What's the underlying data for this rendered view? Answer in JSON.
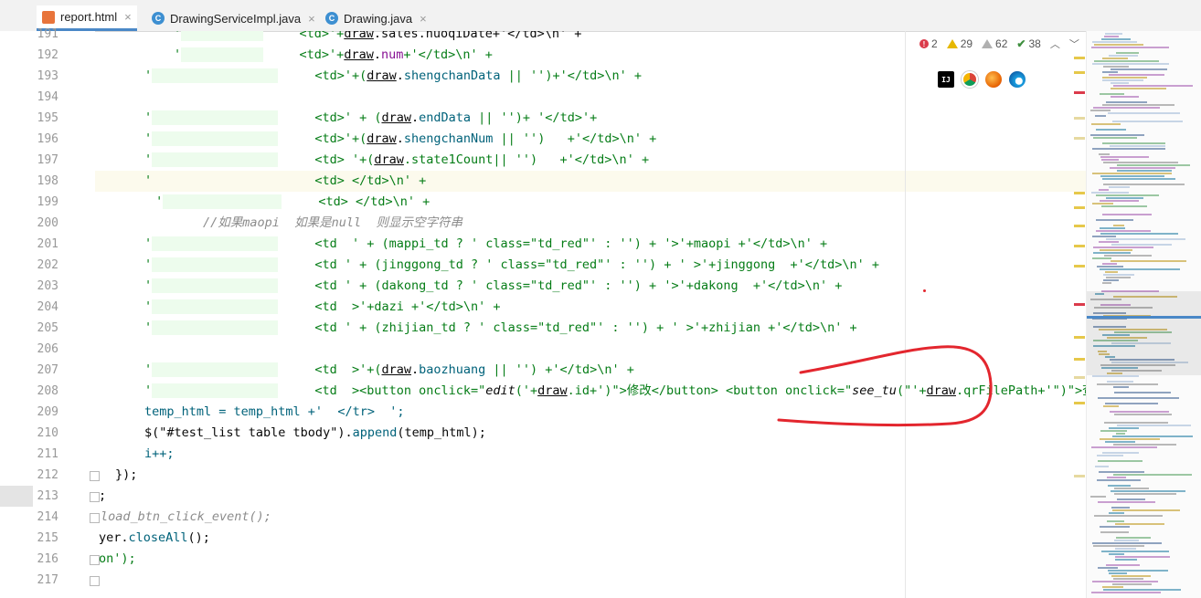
{
  "tabs": [
    {
      "label": "report.html",
      "type": "html",
      "active": true
    },
    {
      "label": "DrawingServiceImpl.java",
      "type": "java",
      "active": false
    },
    {
      "label": "Drawing.java",
      "type": "java",
      "active": false
    }
  ],
  "tab_close_glyph": "×",
  "inspections": {
    "errors": "2",
    "warnings": "29",
    "weak_warnings": "62",
    "typos": "38"
  },
  "browser_icons": [
    "intellij-icon",
    "chrome-icon",
    "firefox-icon",
    "edge-icon"
  ],
  "intellij_icon_text": "IJ",
  "line_numbers": [
    "191",
    "192",
    "193",
    "194",
    "195",
    "196",
    "197",
    "198",
    "199",
    "200",
    "201",
    "202",
    "203",
    "204",
    "205",
    "206",
    "207",
    "208",
    "209",
    "210",
    "211",
    "212",
    "213",
    "214",
    "215",
    "216",
    "217"
  ],
  "code": {
    "l191": {
      "q": "'",
      "a": "<td>'+",
      "b": "draw",
      "c": ".sales.huoqiDate+'</td>\\n' +"
    },
    "l192": {
      "q": "'",
      "a": "<td>'+",
      "b": "draw",
      "c": ".",
      "d": "num",
      "e": "+'</td>\\n' +"
    },
    "l193": {
      "q": "'",
      "a": "<td>'+(",
      "b": "draw",
      "c": ".",
      "d": "shengchanData",
      "e": " || '')+'</td>\\n' +"
    },
    "l195": {
      "q": "'",
      "a": "<td>' + (",
      "b": "draw",
      "c": ".",
      "d": "endData",
      "e": " || '')+ '</td>'+"
    },
    "l196": {
      "q": "'",
      "a": "<td>'+(",
      "b": "draw",
      "c": ".",
      "d": "shengchanNum",
      "e": " || '')   +'</td>\\n' +"
    },
    "l197": {
      "q": "'",
      "a": "<td> '+(",
      "b": "draw",
      "c": ".state1Count|| '')   +'</td>\\n' +"
    },
    "l198": {
      "q": "'",
      "a": "<td> </td>\\n' +"
    },
    "l199": {
      "q": " '",
      "a": "<td> </td>\\n' +"
    },
    "l200": {
      "cmt1": "//如果",
      "cmt2": "maopi",
      "cmt3": "  如果是",
      "cmt4": "null",
      "cmt5": "  则显示空字符串"
    },
    "l201": {
      "q": "'",
      "a": "<td  ' + (mappi_td ? ' class=\"td_red\"' : '') + '>'+maopi +'</td>\\n' +"
    },
    "l202": {
      "q": "'",
      "a": "<td ' + (jinggong_td ? ' class=\"td_red\"' : '') + ' >'+jinggong  +'</td>\\n' +"
    },
    "l203": {
      "q": "'",
      "a": "<td ' + (dakong_td ? ' class=\"td_red\"' : '') + '>'+dakong  +'</td>\\n' +"
    },
    "l204": {
      "q": "'",
      "a": "<td  >'+dazi +'</td>\\n' +"
    },
    "l205": {
      "q": "'",
      "a": "<td ' + (zhijian_td ? ' class=\"td_red\"' : '') + ' >'+zhijian +'</td>\\n' +"
    },
    "l207": {
      "q": "'",
      "a": "<td  >'+(",
      "b": "draw",
      "c": ".",
      "d": "baozhuang",
      "e": " || '') +'</td>\\n' +"
    },
    "l208": {
      "q": "'",
      "a": "<td  ><button onclick=\"",
      "f1": "edit",
      "a2": "('+",
      "b": "draw",
      "c": ".id+')\">修改</button> <button onclick=\"",
      "f2": "see_tu",
      "a3": "(\"'+",
      "b2": "draw",
      "c2": ".qrFilePath+'\")\">查看图纸</but"
    },
    "l209": {
      "a": "temp_html = temp_html +'  </tr>  ';"
    },
    "l210": {
      "a": "$(\"#test_list table tbody\").",
      "fn": "append",
      "e": "(temp_html);"
    },
    "l211": {
      "a": "i++;"
    },
    "l212": {
      "a": "});"
    },
    "l213": {
      "a": ";"
    },
    "l214": {
      "cmt": "load_btn_click_event();"
    },
    "l215": {
      "a": "yer.",
      "fn": "closeAll",
      "e": "();"
    },
    "l216": {
      "a": "on');"
    }
  },
  "colors": {
    "annotation": "#e3262e",
    "string": "#067d17",
    "property": "#871094",
    "function": "#00627a",
    "comment": "#8c8c8c",
    "accent": "#4a88c7"
  }
}
